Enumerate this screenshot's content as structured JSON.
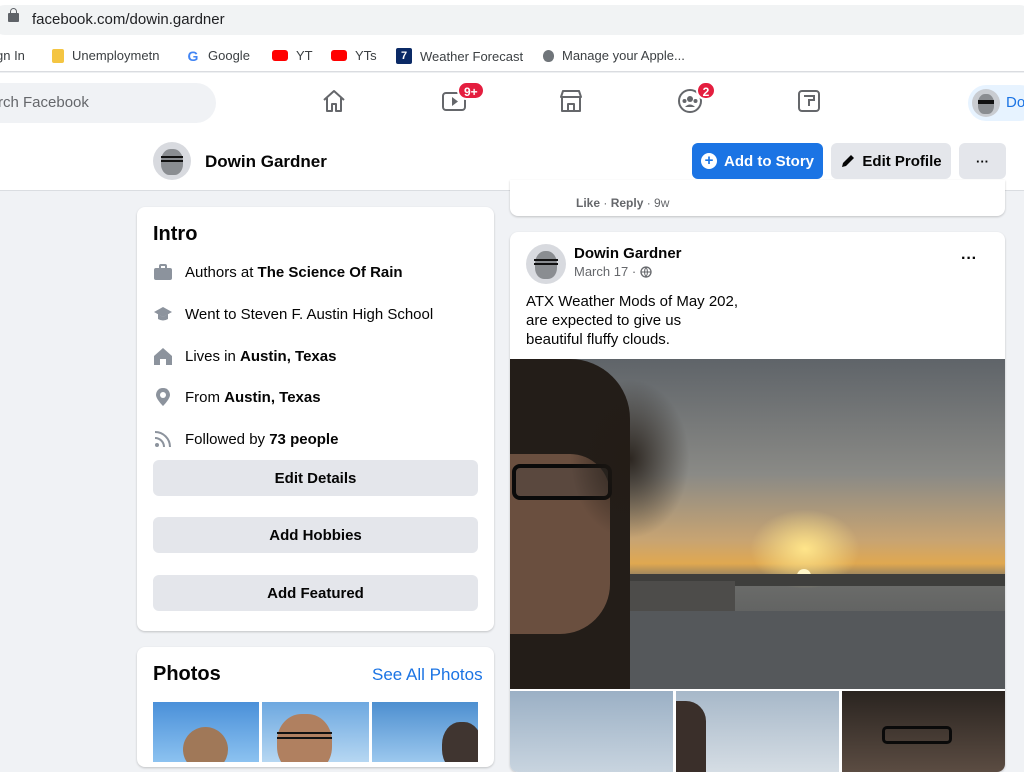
{
  "browser": {
    "url": "facebook.com/dowin.gardner"
  },
  "bookmarks": [
    {
      "label": "gn In",
      "icon": "sign-in-icon"
    },
    {
      "label": "Unemploymetn",
      "icon": "folder-icon"
    },
    {
      "label": "Google",
      "icon": "google-icon"
    },
    {
      "label": "YT",
      "icon": "youtube-icon"
    },
    {
      "label": "YTs",
      "icon": "youtube-icon"
    },
    {
      "label": "Weather Forecast",
      "icon": "fox7-icon"
    },
    {
      "label": "Manage your Apple...",
      "icon": "apple-icon"
    }
  ],
  "nav": {
    "search_placeholder": "rch Facebook",
    "watch_badge": "9+",
    "groups_badge": "2",
    "me_label": "Do"
  },
  "profile": {
    "name": "Dowin Gardner",
    "add_story": "Add to Story",
    "edit_profile": "Edit Profile",
    "more": "···"
  },
  "intro": {
    "title": "Intro",
    "work_prefix": "Authors at ",
    "work": "The Science Of Rain",
    "education": "Went to Steven F. Austin High School",
    "lives_prefix": "Lives in ",
    "lives": "Austin, Texas",
    "from_prefix": "From ",
    "from": "Austin, Texas",
    "followed_prefix": "Followed by ",
    "followed": "73 people",
    "edit_details": "Edit Details",
    "add_hobbies": "Add Hobbies",
    "add_featured": "Add Featured"
  },
  "photos": {
    "title": "Photos",
    "see_all": "See All Photos"
  },
  "prev_post": {
    "like": "Like",
    "reply": "Reply",
    "time": "9w"
  },
  "post": {
    "author": "Dowin Gardner",
    "date": "March 17",
    "line1": "ATX Weather Mods of May 202,",
    "line2": "are expected to give us",
    "line3": "beautiful fluffy clouds.",
    "more": "···"
  },
  "colors": {
    "fb_blue": "#1b74e4",
    "badge_red": "#e41e3f"
  }
}
